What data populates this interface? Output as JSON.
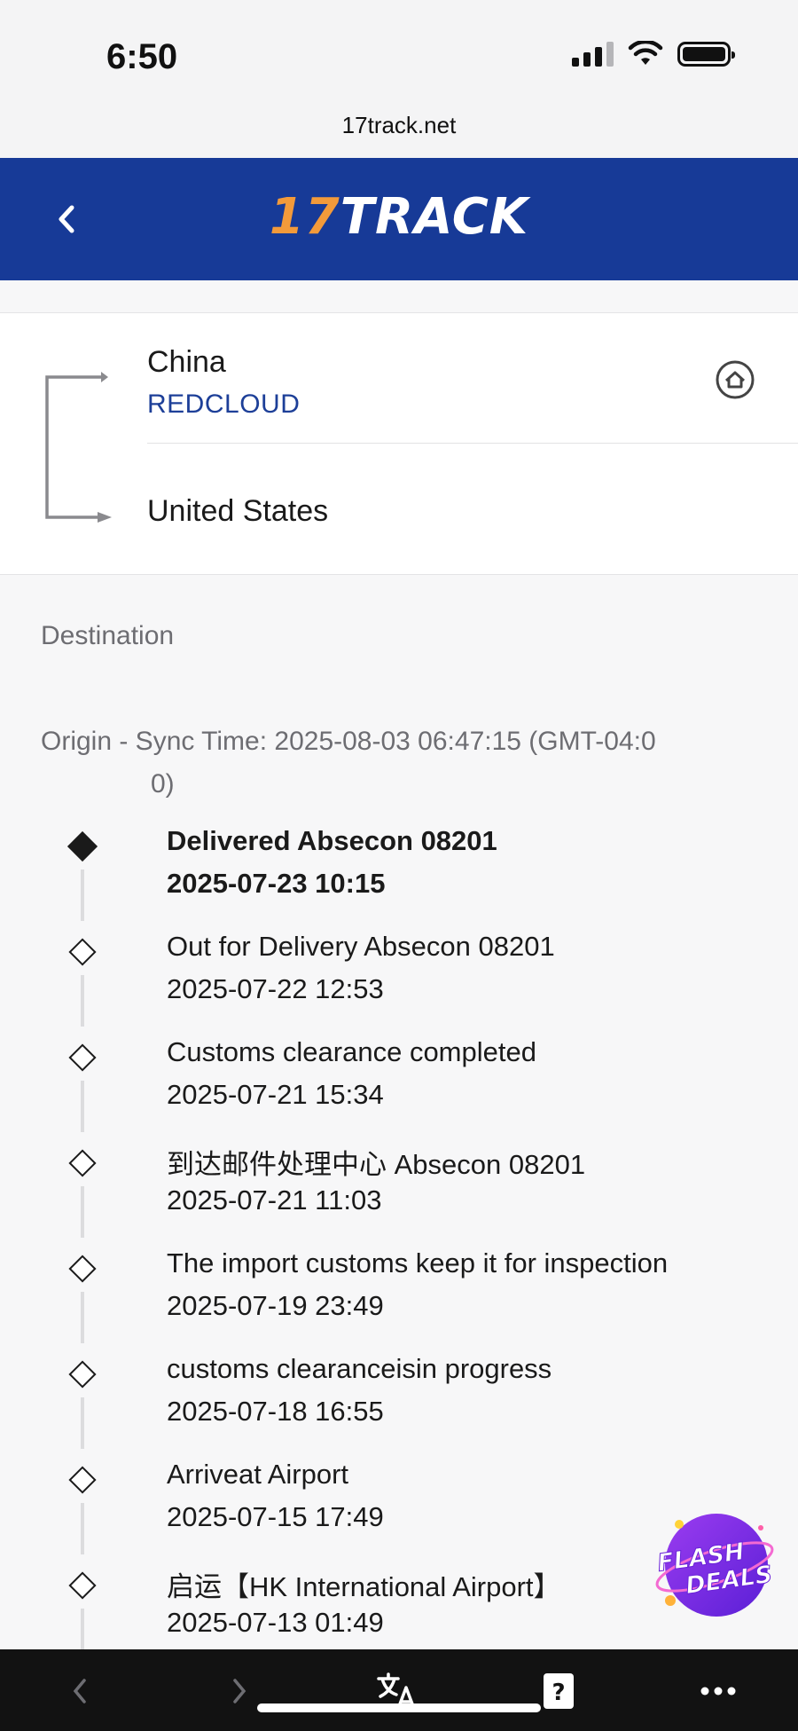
{
  "status_bar": {
    "time": "6:50"
  },
  "browser": {
    "url": "17track.net"
  },
  "header": {
    "logo_number": "17",
    "logo_word": "TRACK"
  },
  "route": {
    "origin": "China",
    "carrier": "REDCLOUD",
    "destination": "United States"
  },
  "section": {
    "label": "Destination"
  },
  "sync": {
    "line1": "Origin - Sync Time: 2025-08-03 06:47:15 (GMT-04:0",
    "line2": "0)"
  },
  "events": [
    {
      "desc": "Delivered Absecon 08201",
      "time": "2025-07-23 10:15",
      "current": true
    },
    {
      "desc": "Out for Delivery Absecon 08201",
      "time": "2025-07-22 12:53"
    },
    {
      "desc": "Customs clearance completed",
      "time": "2025-07-21 15:34"
    },
    {
      "desc": "到达邮件处理中心 Absecon 08201",
      "time": "2025-07-21 11:03"
    },
    {
      "desc": "The import customs keep it for inspection",
      "time": "2025-07-19 23:49"
    },
    {
      "desc": "customs clearanceisin progress",
      "time": "2025-07-18 16:55"
    },
    {
      "desc": "Arriveat Airport",
      "time": "2025-07-15 17:49"
    },
    {
      "desc": "启运【HK International Airport】",
      "time": "2025-07-13 01:49"
    }
  ],
  "promo": {
    "line1": "FLASH",
    "line2": "DEALS"
  },
  "colors": {
    "header_bg": "#173a97",
    "logo_accent": "#f39a3a",
    "carrier_link": "#1d3f98"
  }
}
